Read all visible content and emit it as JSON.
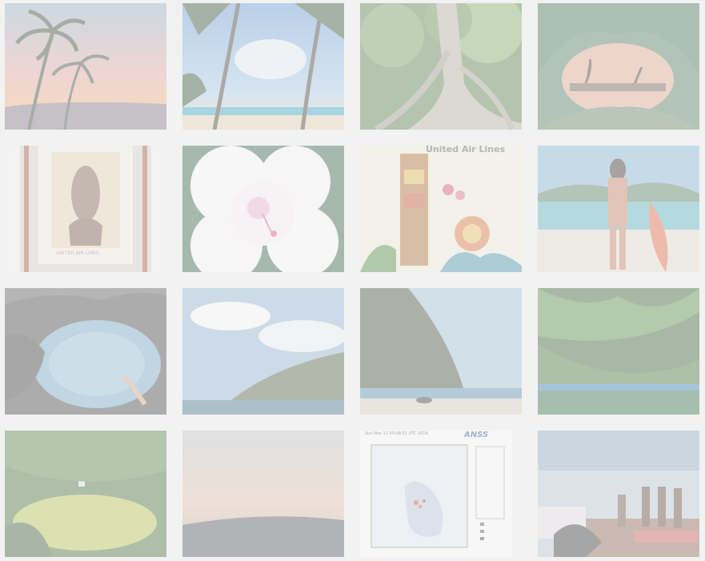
{
  "gallery": {
    "tiles": [
      {
        "id": "palm-sunset"
      },
      {
        "id": "palm-beach"
      },
      {
        "id": "banyan-roots"
      },
      {
        "id": "wave-tube"
      },
      {
        "id": "vintage-poster",
        "text": "UNITED AIR LINES"
      },
      {
        "id": "hibiscus-flower"
      },
      {
        "id": "tiki-poster",
        "text": "United Air Lines"
      },
      {
        "id": "surfer-beach"
      },
      {
        "id": "tide-pool-swimmer"
      },
      {
        "id": "coastal-cliff-clouds"
      },
      {
        "id": "sea-cliff-beach"
      },
      {
        "id": "green-cliff-shore"
      },
      {
        "id": "waterfall-pool"
      },
      {
        "id": "hazy-horizon"
      },
      {
        "id": "earthquake-map",
        "title": "Sun Nov 11 00:09:52 UTC 2018",
        "logo": "ANSS"
      },
      {
        "id": "hula-dancers"
      }
    ]
  }
}
